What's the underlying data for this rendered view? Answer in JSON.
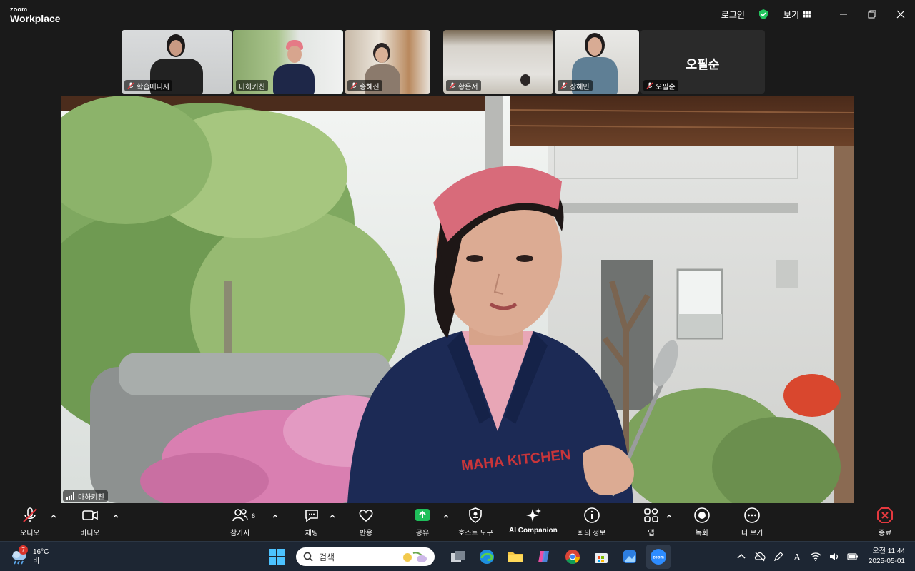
{
  "app": {
    "brand_top": "zoom",
    "brand_bottom": "Workplace"
  },
  "titlebar": {
    "login_label": "로그인",
    "view_label": "보기"
  },
  "thumbnails": [
    {
      "name": "학습매니저",
      "muted": true,
      "active": false
    },
    {
      "name": "마하키친",
      "muted": true,
      "active": true
    },
    {
      "name": "송혜진",
      "muted": true,
      "active": false
    },
    {
      "name": "황은서",
      "muted": true,
      "active": false
    },
    {
      "name": "장혜민",
      "muted": true,
      "active": false
    },
    {
      "name": "오필순",
      "muted": true,
      "active": false,
      "video_off": true
    }
  ],
  "main_video": {
    "speaker_name": "마하키친",
    "apron_text": "MAHA KITCHEN"
  },
  "toolbar": {
    "audio": "오디오",
    "video": "비디오",
    "participants": "참가자",
    "participants_count": "6",
    "chat": "채팅",
    "reactions": "반응",
    "share": "공유",
    "host_tools": "호스트 도구",
    "ai_companion": "AI Companion",
    "meeting_info": "회의 정보",
    "apps": "앱",
    "record": "녹화",
    "more": "더 보기",
    "end": "종료"
  },
  "taskbar": {
    "weather_badge": "7",
    "temperature": "16°C",
    "weather_desc": "비",
    "search_placeholder": "검색",
    "clock_period": "오전 11:44",
    "date": "2025-05-01"
  },
  "colors": {
    "accent_green": "#2ecc71",
    "share_green": "#1fbf5b",
    "end_red": "#e5393f",
    "taskbar_bg": "#1d2633"
  }
}
